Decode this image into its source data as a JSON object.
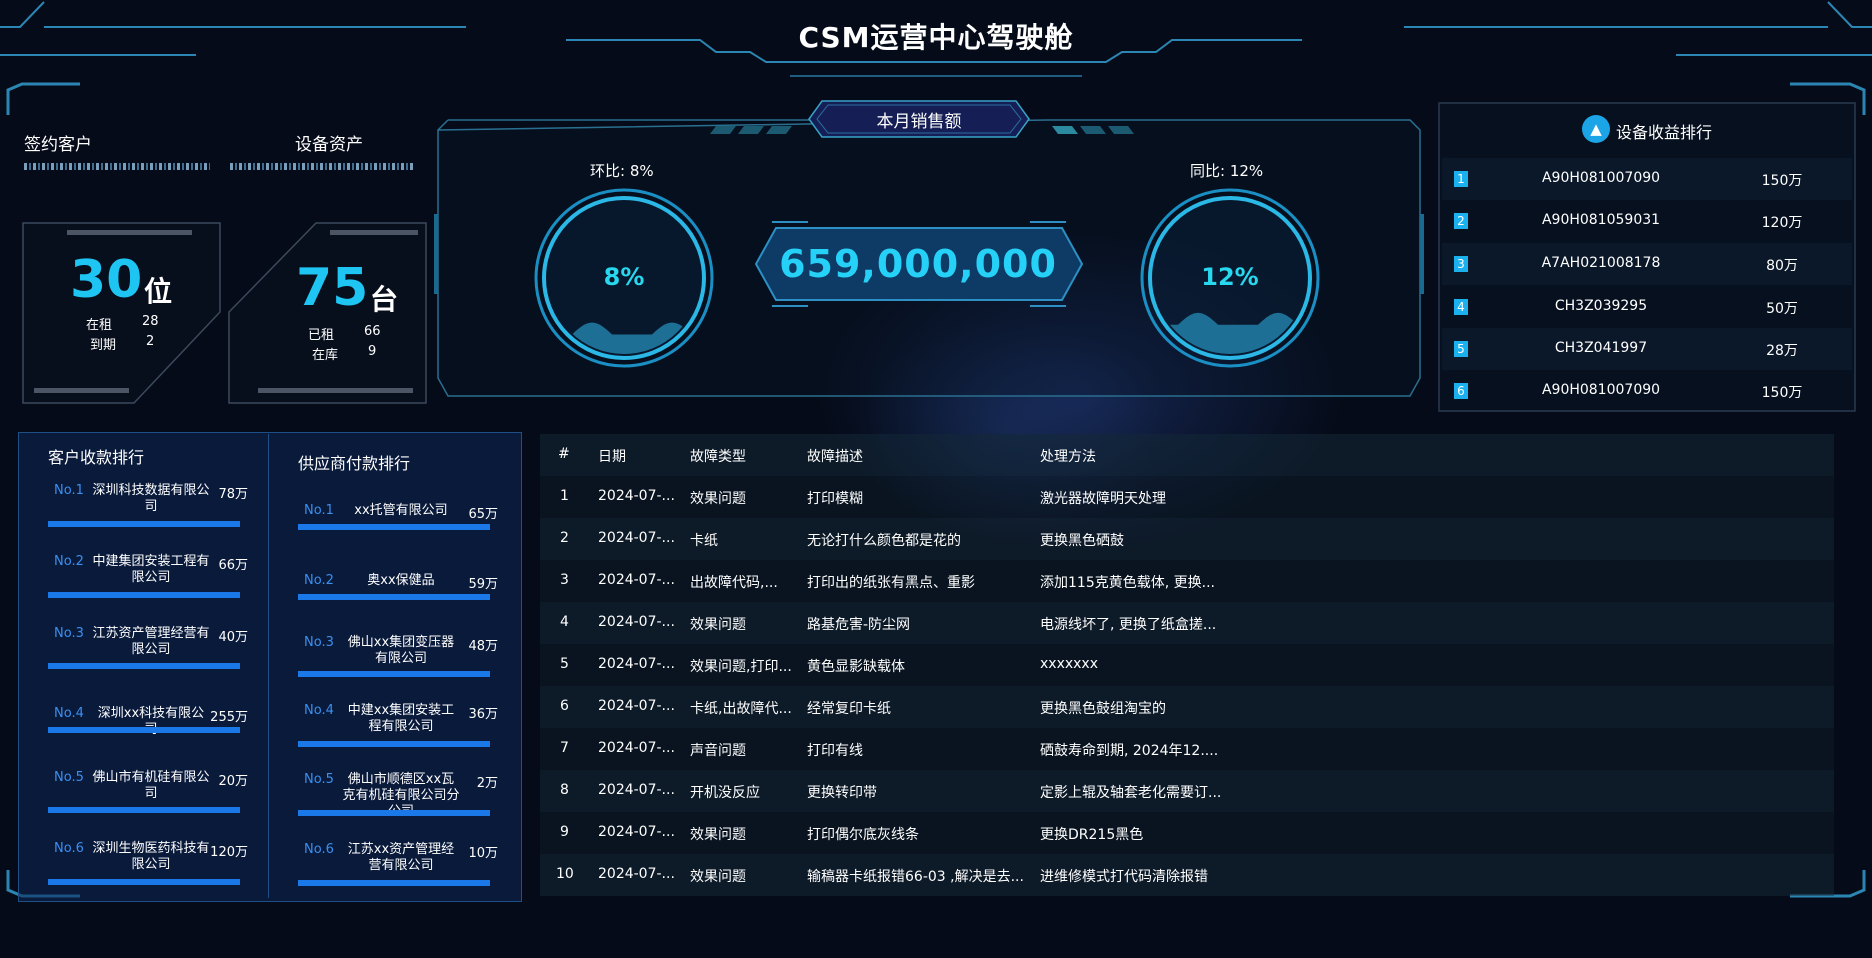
{
  "header": {
    "title": "CSM运营中心驾驶舱"
  },
  "stats": {
    "customers": {
      "label": "签约客户",
      "value": "30",
      "unit": "位",
      "rows": [
        {
          "k": "在租",
          "v": "28"
        },
        {
          "k": "到期",
          "v": "2"
        }
      ]
    },
    "assets": {
      "label": "设备资产",
      "value": "75",
      "unit": "台",
      "rows": [
        {
          "k": "已租",
          "v": "66"
        },
        {
          "k": "在库",
          "v": "9"
        }
      ]
    }
  },
  "sales": {
    "title": "本月销售额",
    "amount": "659,000,000",
    "mom_label": "环比: 8%",
    "yoy_label": "同比: 12%",
    "mom_value": "8%",
    "yoy_value": "12%",
    "mom_fraction": 0.08,
    "yoy_fraction": 0.12
  },
  "device_ranking": {
    "title": "设备收益排行",
    "rows": [
      {
        "idx": "1",
        "code": "A90H081007090",
        "amount": "150万"
      },
      {
        "idx": "2",
        "code": "A90H081059031",
        "amount": "120万"
      },
      {
        "idx": "3",
        "code": "A7AH021008178",
        "amount": "80万"
      },
      {
        "idx": "4",
        "code": "CH3Z039295",
        "amount": "50万"
      },
      {
        "idx": "5",
        "code": "CH3Z041997",
        "amount": "28万"
      },
      {
        "idx": "6",
        "code": "A90H081007090",
        "amount": "150万"
      }
    ]
  },
  "customer_payments": {
    "title": "客户收款排行",
    "items": [
      {
        "no": "No.1",
        "name": "深圳科技数据有限公司",
        "value": "78万"
      },
      {
        "no": "No.2",
        "name": "中建集团安装工程有限公司",
        "value": "66万"
      },
      {
        "no": "No.3",
        "name": "江苏资产管理经营有限公司",
        "value": "40万"
      },
      {
        "no": "No.4",
        "name": "深圳xx科技有限公司",
        "value": "255万"
      },
      {
        "no": "No.5",
        "name": "佛山市有机硅有限公司",
        "value": "20万"
      },
      {
        "no": "No.6",
        "name": "深圳生物医药科技有限公司",
        "value": "120万"
      }
    ]
  },
  "supplier_payments": {
    "title": "供应商付款排行",
    "items": [
      {
        "no": "No.1",
        "name": "xx托管有限公司",
        "value": "65万"
      },
      {
        "no": "No.2",
        "name": "奥xx保健品",
        "value": "59万"
      },
      {
        "no": "No.3",
        "name": "佛山xx集团变压器有限公司",
        "value": "48万"
      },
      {
        "no": "No.4",
        "name": "中建xx集团安装工程有限公司",
        "value": "36万"
      },
      {
        "no": "No.5",
        "name": "佛山市顺德区xx瓦克有机硅有限公司分公司",
        "value": "2万"
      },
      {
        "no": "No.6",
        "name": "江苏xx资产管理经营有限公司",
        "value": "10万"
      }
    ]
  },
  "fault_table": {
    "columns": [
      "#",
      "日期",
      "故障类型",
      "故障描述",
      "处理方法"
    ],
    "rows": [
      [
        "1",
        "2024-07-...",
        "效果问题",
        "打印模糊",
        "激光器故障明天处理"
      ],
      [
        "2",
        "2024-07-...",
        "卡纸",
        "无论打什么颜色都是花的",
        "更换黑色硒鼓"
      ],
      [
        "3",
        "2024-07-...",
        "出故障代码,...",
        "打印出的纸张有黑点、重影",
        "添加115克黄色载体, 更换..."
      ],
      [
        "4",
        "2024-07-...",
        "效果问题",
        "路基危害-防尘网",
        "电源线坏了, 更换了纸盒搓..."
      ],
      [
        "5",
        "2024-07-...",
        "效果问题,打印...",
        "黄色显影缺载体",
        "xxxxxxx"
      ],
      [
        "6",
        "2024-07-...",
        "卡纸,出故障代...",
        "经常复印卡纸",
        "更换黑色鼓组淘宝的"
      ],
      [
        "7",
        "2024-07-...",
        "声音问题",
        "打印有线",
        "硒鼓寿命到期, 2024年12...."
      ],
      [
        "8",
        "2024-07-...",
        "开机没反应",
        "更换转印带",
        "定影上辊及轴套老化需要订..."
      ],
      [
        "9",
        "2024-07-...",
        "效果问题",
        "打印偶尔底灰线条",
        "更换DR215黑色"
      ],
      [
        "10",
        "2024-07-...",
        "效果问题",
        "输稿器卡纸报错66-03 ,解决是去...",
        "进维修模式打代码清除报错"
      ]
    ]
  }
}
